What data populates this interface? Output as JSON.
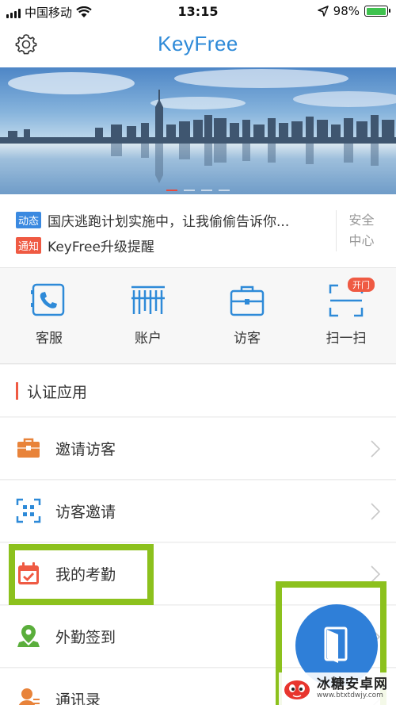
{
  "status_bar": {
    "carrier": "中国移动",
    "time": "13:15",
    "battery": "98%",
    "battery_level": 0.98
  },
  "header": {
    "title": "KeyFree",
    "settings_icon": "gear-icon"
  },
  "banner": {
    "slide_count": 4,
    "active_slide": 1
  },
  "notices": [
    {
      "tag": "动态",
      "text": "国庆逃跑计划实施中，让我偷偷告诉你...",
      "tag_color": "#3a89e0"
    },
    {
      "tag": "通知",
      "text": "KeyFree升级提醒",
      "tag_color": "#ef5a43"
    }
  ],
  "safety_center": {
    "line1": "安全",
    "line2": "中心"
  },
  "quick_actions": [
    {
      "label": "客服",
      "icon": "phone-icon"
    },
    {
      "label": "账户",
      "icon": "barcode-icon"
    },
    {
      "label": "访客",
      "icon": "briefcase-icon"
    },
    {
      "label": "扫一扫",
      "icon": "scan-icon",
      "badge": "开门"
    }
  ],
  "section": {
    "title": "认证应用"
  },
  "menu": [
    {
      "label": "邀请访客",
      "icon": "briefcase-icon"
    },
    {
      "label": "访客邀请",
      "icon": "qr-code-icon"
    },
    {
      "label": "我的考勤",
      "icon": "calendar-check-icon"
    },
    {
      "label": "外勤签到",
      "icon": "location-pin-icon"
    },
    {
      "label": "通讯录",
      "icon": "contact-icon"
    }
  ],
  "fab": {
    "icon": "door-icon"
  },
  "watermark": {
    "text": "冰糖安卓网",
    "url": "www.btxtdwjy.com"
  },
  "colors": {
    "brand": "#2e8ad8",
    "accent_red": "#ef5a43",
    "highlight": "#8cc11d"
  }
}
